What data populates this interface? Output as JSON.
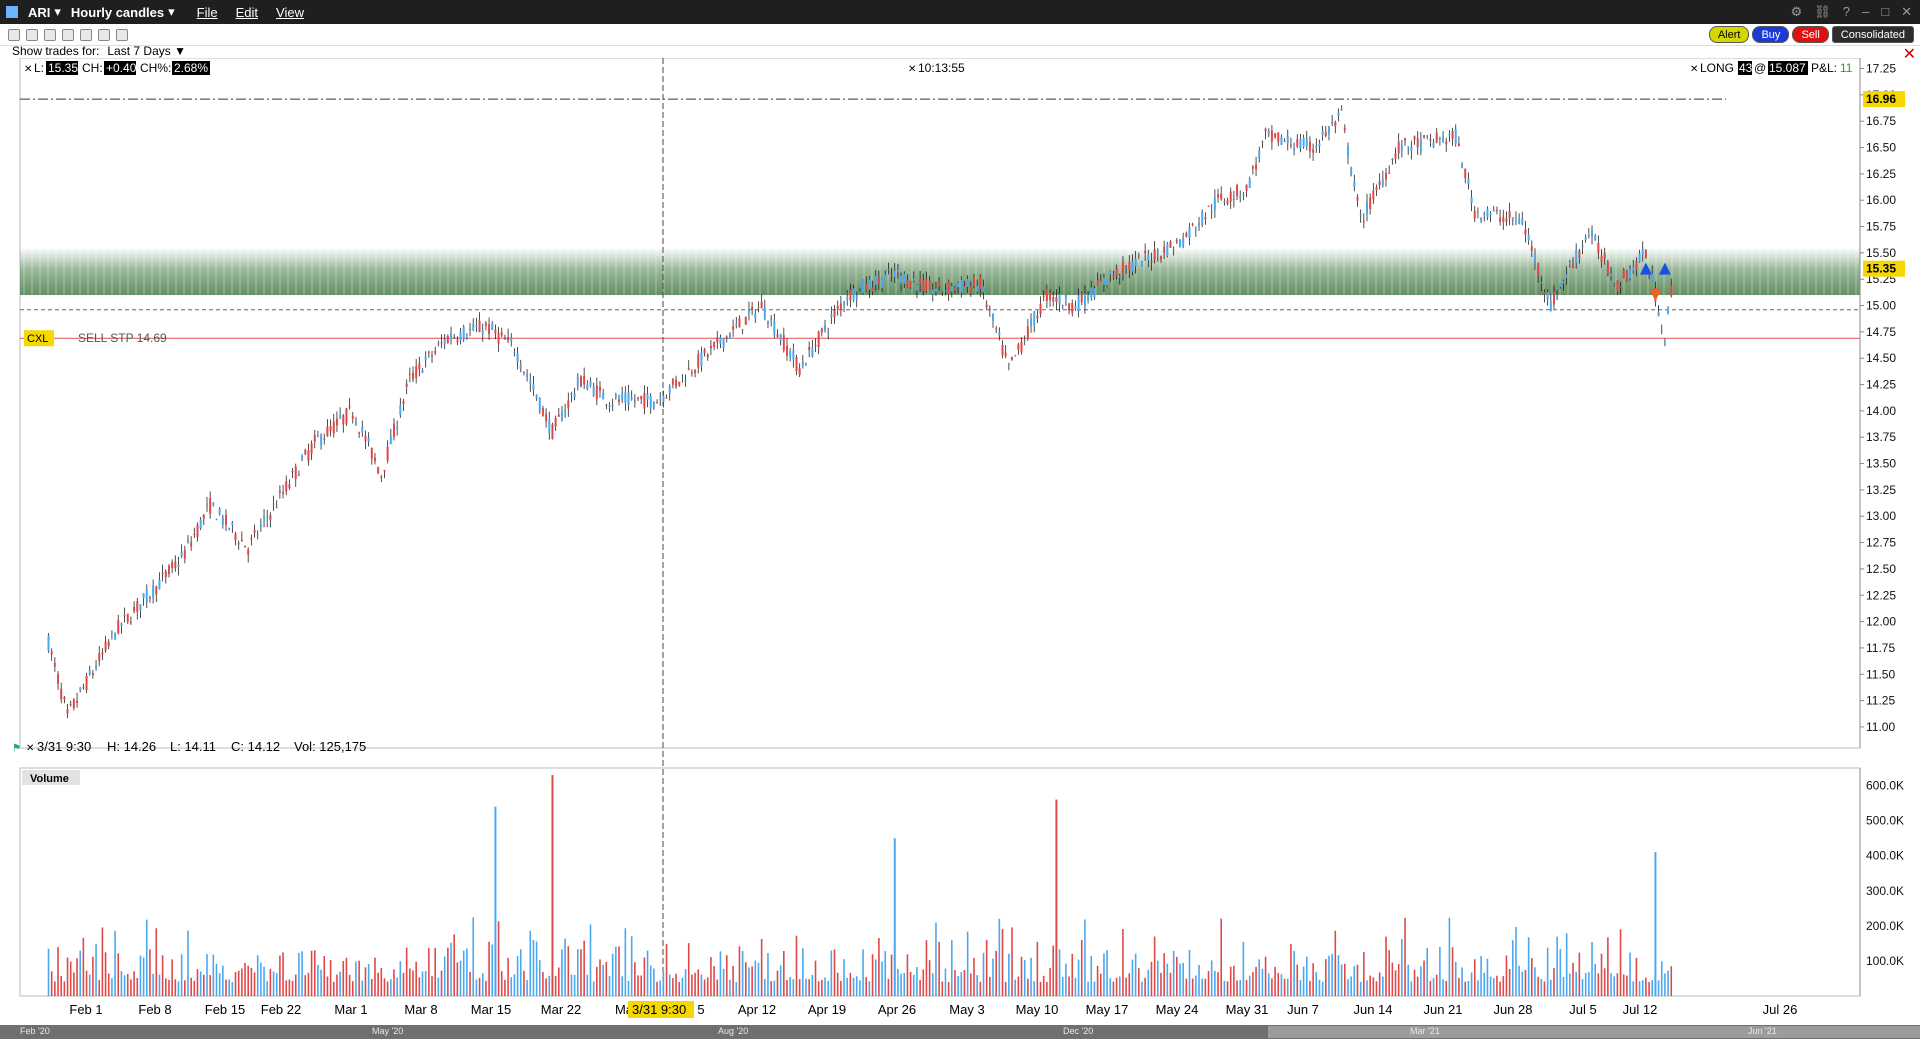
{
  "window": {
    "symbol": "ARI",
    "title": "Hourly candles",
    "menu": [
      "File",
      "Edit",
      "View"
    ]
  },
  "toolbar": {
    "alert": "Alert",
    "buy": "Buy",
    "sell": "Sell",
    "consolidated": "Consolidated"
  },
  "show_trades": {
    "label": "Show trades for:",
    "value": "Last 7 Days"
  },
  "header": {
    "last_label": "L:",
    "last": "15.35",
    "change_label": "CH:",
    "change": "+0.40",
    "pct_label": "CH%:",
    "pct": "2.68%",
    "time": "10:13:55",
    "position_label": "LONG",
    "position_qty": "43",
    "at": "@",
    "avg_price": "15.087",
    "pnl_label": "P&L:",
    "pnl": "11"
  },
  "order": {
    "tag": "CXL",
    "text": "SELL STP 14.69",
    "price": 14.69
  },
  "crosshair_info": {
    "time": "3/31 9:30",
    "high": "H: 14.26",
    "low": "L: 14.11",
    "close": "C: 14.12",
    "vol": "Vol: 125,175"
  },
  "volume_label": "Volume",
  "price_axis": {
    "ticks": [
      "17.25",
      "17.00",
      "16.75",
      "16.50",
      "16.25",
      "16.00",
      "15.75",
      "15.50",
      "15.25",
      "15.00",
      "14.75",
      "14.50",
      "14.25",
      "14.00",
      "13.75",
      "13.50",
      "13.25",
      "13.00",
      "12.75",
      "12.50",
      "12.25",
      "12.00",
      "11.75",
      "11.50",
      "11.25",
      "11.00"
    ],
    "high_tag": "16.96",
    "last_tag": "15.35"
  },
  "volume_axis": {
    "ticks": [
      "600.0K",
      "500.0K",
      "400.0K",
      "300.0K",
      "200.0K",
      "100.0K"
    ]
  },
  "time_axis": {
    "labels": [
      "Feb 1",
      "Feb 8",
      "Feb 15",
      "Feb 22",
      "Mar 1",
      "Mar 8",
      "Mar 15",
      "Mar 22",
      "Ma",
      "3/31 9:30",
      "5",
      "Apr 12",
      "Apr 19",
      "Apr 26",
      "May 3",
      "May 10",
      "May 17",
      "May 24",
      "May 31",
      "Jun 7",
      "Jun 14",
      "Jun 21",
      "Jun 28",
      "Jul 5",
      "Jul 12",
      "Jul 26"
    ]
  },
  "scrollbar": {
    "labels": [
      "Feb '20",
      "May '20",
      "Aug '20",
      "Dec '20",
      "Mar '21",
      "Jun '21"
    ]
  },
  "colors": {
    "up": "#4aa8f0",
    "down": "#e04848",
    "zone": "#5b8a5b",
    "order_line": "#e05050",
    "crosshair": "#444444",
    "price_tag": "#f5d800"
  },
  "chart_data": {
    "type": "candlestick",
    "ylim": [
      10.8,
      17.35
    ],
    "volume_ylim": [
      0,
      650000
    ],
    "resistance_zone": [
      15.1,
      15.55
    ],
    "high_line": 16.96,
    "dashed_line": 14.96,
    "anchors": [
      {
        "date": "Feb 1",
        "price": 11.8
      },
      {
        "date": "Feb 3",
        "price": 11.1
      },
      {
        "date": "Feb 8",
        "price": 11.9
      },
      {
        "date": "Feb 15",
        "price": 12.6
      },
      {
        "date": "Feb 18",
        "price": 13.1
      },
      {
        "date": "Feb 22",
        "price": 12.7
      },
      {
        "date": "Mar 1",
        "price": 13.7
      },
      {
        "date": "Mar 5",
        "price": 14.0
      },
      {
        "date": "Mar 8",
        "price": 13.4
      },
      {
        "date": "Mar 11",
        "price": 14.3
      },
      {
        "date": "Mar 15",
        "price": 14.7
      },
      {
        "date": "Mar 19",
        "price": 14.8
      },
      {
        "date": "Mar 22",
        "price": 14.6
      },
      {
        "date": "Mar 26",
        "price": 13.8
      },
      {
        "date": "Mar 29",
        "price": 14.3
      },
      {
        "date": "Apr 1",
        "price": 14.1
      },
      {
        "date": "Apr 6",
        "price": 14.1
      },
      {
        "date": "Apr 12",
        "price": 14.6
      },
      {
        "date": "Apr 17",
        "price": 15.0
      },
      {
        "date": "Apr 21",
        "price": 14.4
      },
      {
        "date": "Apr 26",
        "price": 15.1
      },
      {
        "date": "May 1",
        "price": 15.3
      },
      {
        "date": "May 5",
        "price": 15.15
      },
      {
        "date": "May 10",
        "price": 15.2
      },
      {
        "date": "May 13",
        "price": 14.4
      },
      {
        "date": "May 17",
        "price": 15.1
      },
      {
        "date": "May 20",
        "price": 15.0
      },
      {
        "date": "May 24",
        "price": 15.3
      },
      {
        "date": "May 31",
        "price": 15.6
      },
      {
        "date": "Jun 4",
        "price": 16.0
      },
      {
        "date": "Jun 7",
        "price": 16.1
      },
      {
        "date": "Jun 9",
        "price": 16.6
      },
      {
        "date": "Jun 14",
        "price": 16.5
      },
      {
        "date": "Jun 17",
        "price": 16.8
      },
      {
        "date": "Jun 19",
        "price": 15.8
      },
      {
        "date": "Jun 23",
        "price": 16.5
      },
      {
        "date": "Jun 29",
        "price": 16.6
      },
      {
        "date": "Jul 1",
        "price": 15.9
      },
      {
        "date": "Jul 6",
        "price": 15.8
      },
      {
        "date": "Jul 9",
        "price": 15.0
      },
      {
        "date": "Jul 13",
        "price": 15.7
      },
      {
        "date": "Jul 16",
        "price": 15.2
      },
      {
        "date": "Jul 19",
        "price": 15.5
      },
      {
        "date": "Jul 21",
        "price": 14.7
      },
      {
        "date": "Jul 22",
        "price": 15.35
      }
    ],
    "volume_spikes": [
      {
        "date": "Mar 20",
        "value": 540000
      },
      {
        "date": "Mar 26",
        "value": 630000
      },
      {
        "date": "May 1",
        "value": 450000
      },
      {
        "date": "May 18",
        "value": 560000
      },
      {
        "date": "Jul 20",
        "value": 410000
      }
    ],
    "trade_markers": [
      {
        "date": "Jul 19",
        "side": "buy"
      },
      {
        "date": "Jul 20",
        "side": "sell"
      },
      {
        "date": "Jul 21",
        "side": "buy"
      }
    ]
  }
}
